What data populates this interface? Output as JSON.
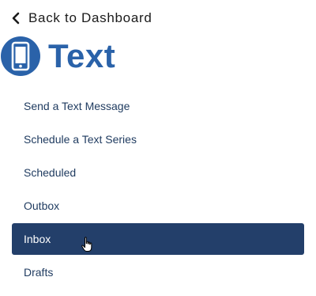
{
  "back": {
    "label": "Back to Dashboard",
    "icon": "chevron-left-icon"
  },
  "header": {
    "title": "Text",
    "icon": "mobile-phone-icon",
    "accent": "#2a62a9"
  },
  "nav": {
    "items": [
      {
        "label": "Send a Text Message",
        "active": false
      },
      {
        "label": "Schedule a Text Series",
        "active": false
      },
      {
        "label": "Scheduled",
        "active": false
      },
      {
        "label": "Outbox",
        "active": false
      },
      {
        "label": "Inbox",
        "active": true
      },
      {
        "label": "Drafts",
        "active": false
      }
    ],
    "active_color": "#233f6a"
  }
}
